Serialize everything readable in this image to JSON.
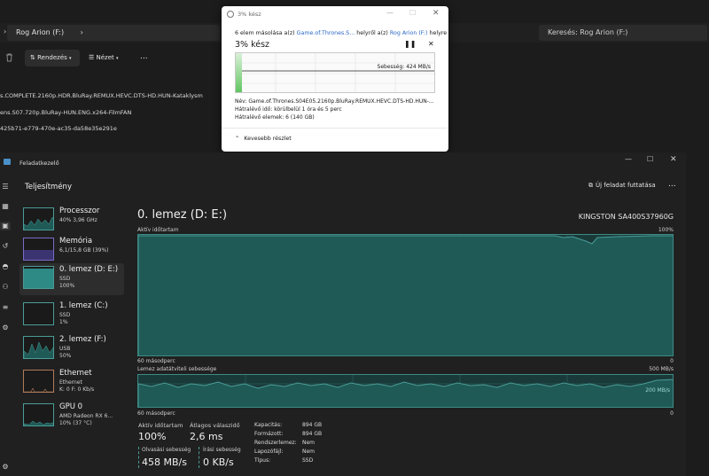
{
  "explorer": {
    "path": "Rog Arion (F:)",
    "search_placeholder": "Keresés: Rog Arion (F:)",
    "sort_label": "Rendezés",
    "view_label": "Nézet",
    "more_label": "...",
    "files": [
      "s.COMPLETE.2160p.HDR.BluRay.REMUX.HEVC.DTS-HD.HUN-Kataklysm",
      "ens.S07.720p.BluRay-HUN.ENG.x264-FilmFAN",
      "425b71-e779-470e-ac35-da58e35e291e"
    ]
  },
  "copy_dialog": {
    "title": "3% kész",
    "desc_prefix": "6 elem másolása a(z) ",
    "desc_source": "Game.of.Thrones.S...",
    "desc_middle": " helyről a(z) ",
    "desc_target": "Rog Arion (F:)",
    "desc_suffix": " helyre",
    "percent": "3% kész",
    "progress": 0.03,
    "speed": "Sebesség: 424 MB/s",
    "name_label": "Név:  Game.of.Thrones.S04E05.2160p.BluRay.REMUX.HEVC.DTS-HD.HUN-...",
    "time_label": "Hátralévő idő:  körülbelül 1 óra és 5 perc",
    "items_label": "Hátralévő elemek:  6 (140 GB)",
    "less_details": "Kevesebb részlet"
  },
  "task_manager": {
    "window_title": "Feladatkezelő",
    "section_title": "Teljesítmény",
    "run_task": "Új feladat futtatása",
    "more": "...",
    "devices": [
      {
        "name": "Processzor",
        "s1": "40%  3,96 GHz",
        "s2": ""
      },
      {
        "name": "Memória",
        "s1": "6,1/15,8 GB (39%)",
        "s2": ""
      },
      {
        "name": "0. lemez (D: E:)",
        "s1": "SSD",
        "s2": "100%"
      },
      {
        "name": "1. lemez (C:)",
        "s1": "SSD",
        "s2": "1%"
      },
      {
        "name": "2. lemez (F:)",
        "s1": "USB",
        "s2": "50%"
      },
      {
        "name": "Ethernet",
        "s1": "Ethernet",
        "s2": "K: 0  F: 0 Kb/s"
      },
      {
        "name": "GPU 0",
        "s1": "AMD Radeon RX 6...",
        "s2": "10% (37 °C)"
      }
    ],
    "disk_title": "0. lemez (D: E:)",
    "disk_model": "KINGSTON SA400S37960G",
    "active_time_label": "Aktív időtartam",
    "active_time_max": "100%",
    "seconds_label": "60 másodperc",
    "zero": "0",
    "transfer_label": "Lemez adatátviteli sebessége",
    "transfer_max": "500 MB/s",
    "transfer_mid": "200 MB/s",
    "stats": {
      "active_label": "Aktív időtartam",
      "active_value": "100%",
      "response_label": "Átlagos válaszidő",
      "response_value": "2,6 ms",
      "read_label": "Olvasási sebesség",
      "read_value": "458 MB/s",
      "write_label": "Írási sebesség",
      "write_value": "0 KB/s"
    },
    "props": [
      {
        "k": "Kapacitás:",
        "v": "894 GB"
      },
      {
        "k": "Formázott:",
        "v": "894 GB"
      },
      {
        "k": "Rendszerlemez:",
        "v": "Nem"
      },
      {
        "k": "Lapozófájl:",
        "v": "Nem"
      },
      {
        "k": "Típus:",
        "v": "SSD"
      }
    ]
  },
  "colors": {
    "teal": "#3c8a85",
    "fill": "#1f5a57",
    "selected": "#2d2d2d",
    "accent_blue": "#2a66c4"
  }
}
